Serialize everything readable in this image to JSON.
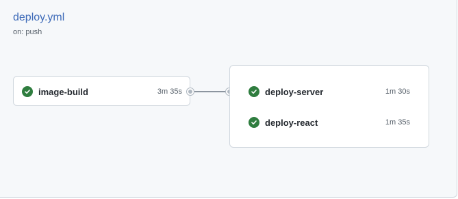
{
  "workflow": {
    "title": "deploy.yml",
    "trigger": "on: push"
  },
  "stages": [
    {
      "jobs": [
        {
          "name": "image-build",
          "duration": "3m 35s",
          "status": "success"
        }
      ]
    },
    {
      "jobs": [
        {
          "name": "deploy-server",
          "duration": "1m 30s",
          "status": "success"
        },
        {
          "name": "deploy-react",
          "duration": "1m 35s",
          "status": "success"
        }
      ]
    }
  ],
  "colors": {
    "success": "#2f7d3f",
    "link": "#3d6ab8",
    "connector": "#8c959f"
  },
  "icons": {
    "status": "check-circle-icon"
  }
}
